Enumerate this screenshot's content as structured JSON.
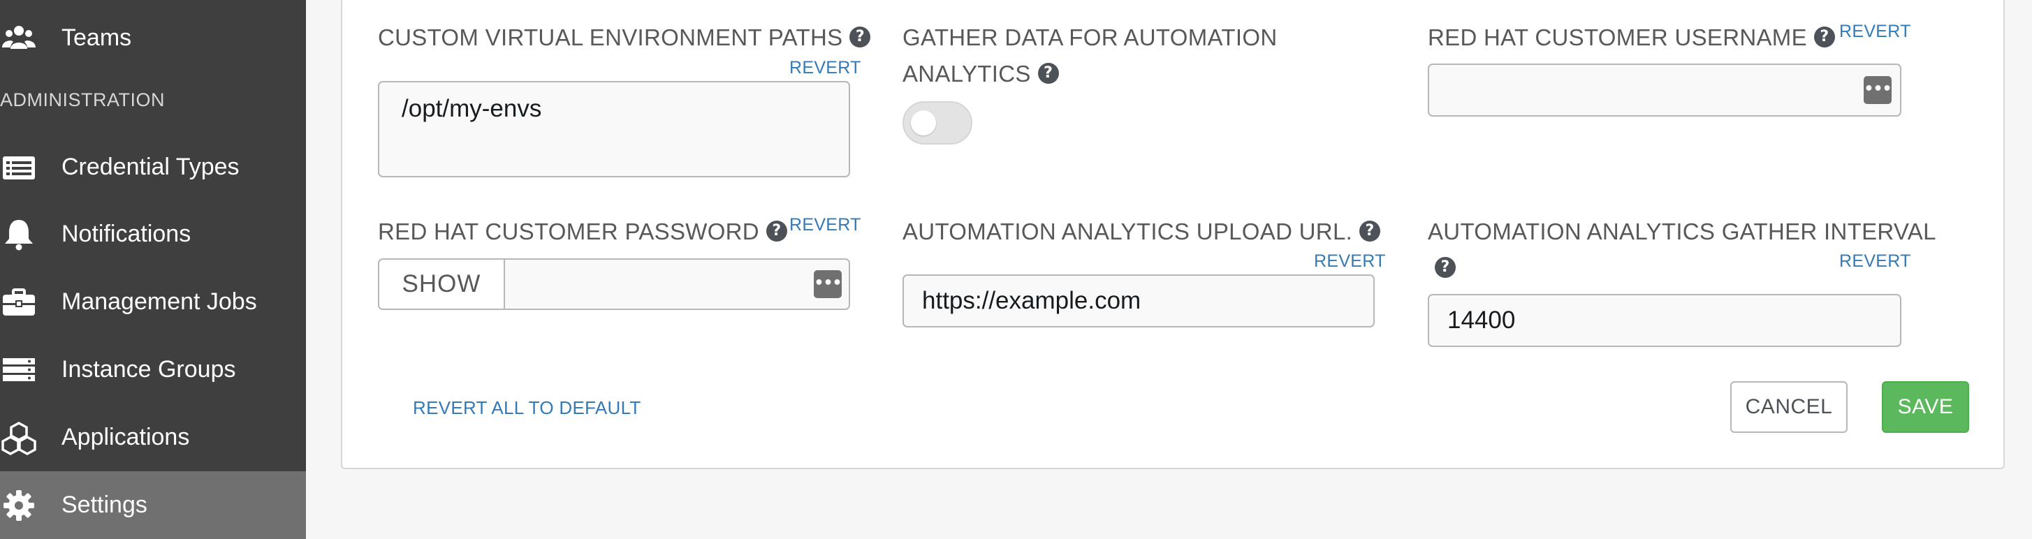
{
  "sidebar": {
    "section_administration": "ADMINISTRATION",
    "items": [
      {
        "label": "Teams",
        "icon": "users-icon"
      },
      {
        "label": "Credential Types",
        "icon": "list-icon"
      },
      {
        "label": "Notifications",
        "icon": "bell-icon"
      },
      {
        "label": "Management Jobs",
        "icon": "briefcase-icon"
      },
      {
        "label": "Instance Groups",
        "icon": "server-icon"
      },
      {
        "label": "Applications",
        "icon": "cubes-icon"
      },
      {
        "label": "Settings",
        "icon": "gear-icon",
        "active": true
      }
    ]
  },
  "form": {
    "venv_paths": {
      "label": "CUSTOM VIRTUAL ENVIRONMENT PATHS",
      "revert": "REVERT",
      "value": "/opt/my-envs"
    },
    "gather_data": {
      "label_line1": "GATHER DATA FOR AUTOMATION",
      "label_line2": "ANALYTICS",
      "enabled": false
    },
    "rh_username": {
      "label": "RED HAT CUSTOMER USERNAME",
      "revert": "REVERT",
      "value": ""
    },
    "rh_password": {
      "label": "RED HAT CUSTOMER PASSWORD",
      "revert": "REVERT",
      "show_label": "SHOW",
      "value": ""
    },
    "upload_url": {
      "label": "AUTOMATION ANALYTICS UPLOAD URL.",
      "revert": "REVERT",
      "value": "https://example.com"
    },
    "gather_interval": {
      "label": "AUTOMATION ANALYTICS GATHER INTERVAL",
      "revert": "REVERT",
      "value": "14400"
    },
    "help_glyph": "?",
    "dots_glyph": "•••"
  },
  "actions": {
    "revert_all": "REVERT ALL TO DEFAULT",
    "cancel": "CANCEL",
    "save": "SAVE"
  },
  "colors": {
    "sidebar_bg": "#3f3f3f",
    "sidebar_active": "#707070",
    "link": "#337ab7",
    "save_green": "#5cb85c"
  }
}
